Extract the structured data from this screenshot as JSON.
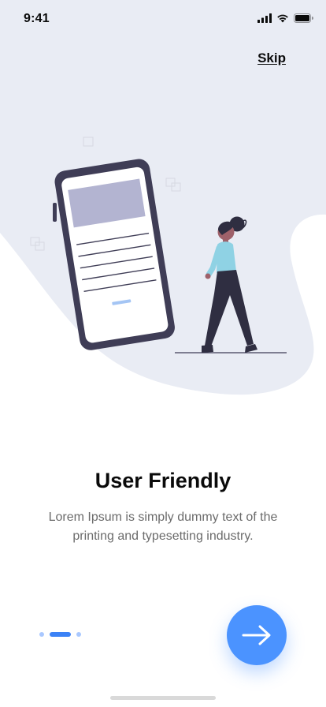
{
  "status_bar": {
    "time": "9:41",
    "icons": [
      "signal-icon",
      "wifi-icon",
      "battery-icon"
    ]
  },
  "header": {
    "skip_label": "Skip"
  },
  "illustration": {
    "icon": "onboarding-illustration"
  },
  "content": {
    "title": "User Friendly",
    "description": "Lorem Ipsum is simply dummy text of the printing and typesetting industry."
  },
  "pager": {
    "page_count": 3,
    "active_page": 2
  },
  "next_button": {
    "icon": "arrow-right-icon"
  },
  "colors": {
    "accent": "#4b93ff",
    "background_shape": "#e9ecf4",
    "text_primary": "#0a0a0a",
    "text_secondary": "#6b6b6b"
  }
}
